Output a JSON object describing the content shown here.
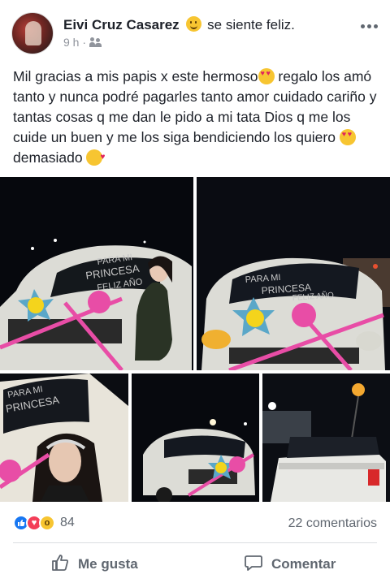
{
  "post": {
    "author": "Eivi Cruz Casarez",
    "feeling": "se siente feliz.",
    "time": "9 h ·",
    "text_parts": [
      "Mil gracias a mis papis x este hermoso",
      " regalo los amó tanto y nunca podré pagarles tanto amor cuidado cariño  y tantas cosas q me dan le pido a mi tata Dios q me los cuide un buen y me los siga bendiciendo los quiero ",
      "demasiado "
    ],
    "car_window_text": [
      "PARA MI",
      "PRINCESA",
      "FELIZ AÑO"
    ]
  },
  "reactions": {
    "count": "84",
    "comments": "22 comentarios"
  },
  "actions": {
    "like": "Me gusta",
    "comment": "Comentar"
  },
  "colors": {
    "accent": "#1877f2",
    "love": "#f33e58",
    "text": "#1d2129",
    "secondary": "#606770"
  },
  "icons": {
    "more": "more-horizontal-icon",
    "audience": "friends-icon",
    "like": "thumbs-up-icon",
    "comment": "speech-bubble-icon"
  }
}
